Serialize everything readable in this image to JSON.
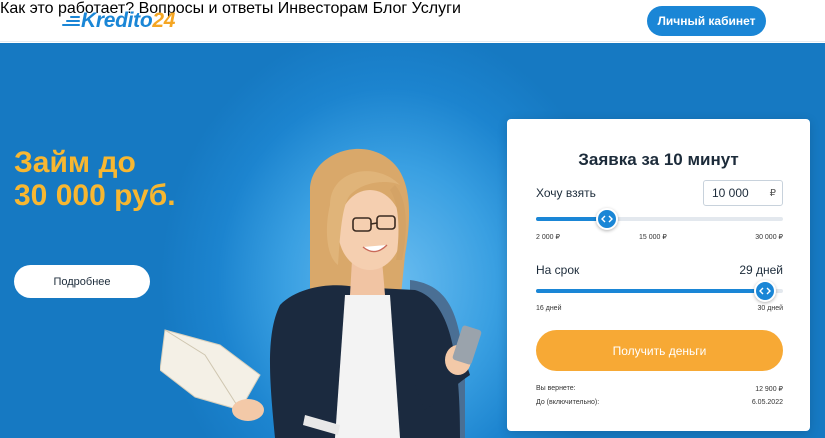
{
  "header": {
    "logo_text": "Kredito",
    "logo_num": "24",
    "nav": [
      "Как это работает?",
      "Вопросы и ответы",
      "Инвесторам",
      "Блог",
      "Услуги"
    ],
    "cabinet_label": "Личный кабинет"
  },
  "hero": {
    "title_line1": "Займ до",
    "title_line2": "30 000 руб.",
    "more_label": "Подробнее"
  },
  "form": {
    "title": "Заявка за 10 минут",
    "amount_label": "Хочу взять",
    "amount_value": "10 000",
    "currency": "₽",
    "amount_slider": {
      "min": 2000,
      "max": 30000,
      "value": 10000,
      "ticks": [
        "2 000 ₽",
        "15 000 ₽",
        "30 000 ₽"
      ]
    },
    "term_label": "На срок",
    "term_value": "29 дней",
    "term_slider": {
      "min": 16,
      "max": 30,
      "value": 29,
      "ticks": [
        "16 дней",
        "30 дней"
      ]
    },
    "submit_label": "Получить деньги",
    "return_label": "Вы вернете:",
    "return_value": "12 900 ₽",
    "until_label": "До (включительно):",
    "until_value": "6.05.2022"
  },
  "colors": {
    "brand_blue": "#1a86d6",
    "accent_orange": "#f7a935",
    "title_yellow": "#f7b731"
  }
}
